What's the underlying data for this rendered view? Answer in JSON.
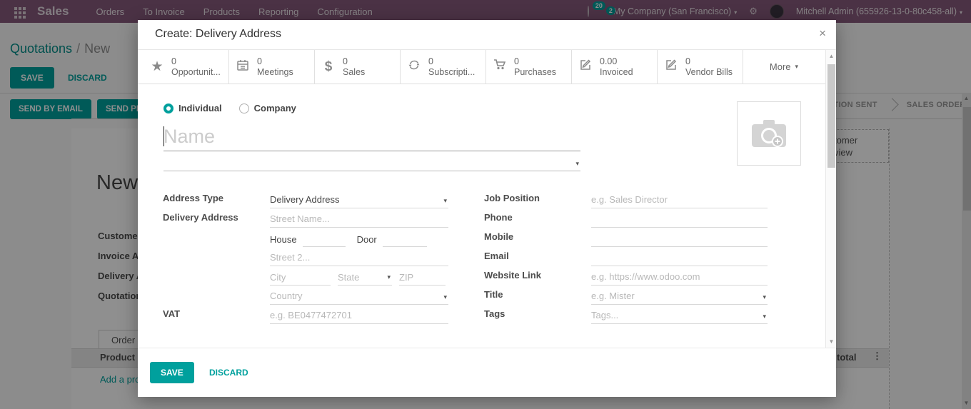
{
  "topbar": {
    "app_name": "Sales",
    "menu_items": [
      "Orders",
      "To Invoice",
      "Products",
      "Reporting",
      "Configuration"
    ],
    "activity_badge": "20",
    "message_badge": "2",
    "company": "My Company (San Francisco)",
    "user": "Mitchell Admin (655926-13-0-80c458-all)",
    "caret": "▾"
  },
  "page": {
    "breadcrumb_parent": "Quotations",
    "breadcrumb_separator": "/",
    "breadcrumb_current": "New",
    "save": "SAVE",
    "discard": "DISCARD",
    "send_by_email": "SEND BY EMAIL",
    "send_pr": "SEND PR",
    "status_steps": [
      "ATION SENT",
      "SALES ORDER"
    ],
    "record_title": "New",
    "field_labels": [
      "Customer",
      "Invoice A",
      "Delivery A",
      "Quotation"
    ],
    "preview_line1": "tomer",
    "preview_line2": "view",
    "tab_order_lines": "Order L",
    "col_product": "Product",
    "col_total": "total",
    "kebab": "⋮",
    "add_line": "Add a pro",
    "scroll_up": "▲",
    "scroll_down": "▼"
  },
  "modal": {
    "title": "Create: Delivery Address",
    "close": "×",
    "stats": [
      {
        "value": "0",
        "label": "Opportunit..."
      },
      {
        "value": "0",
        "label": "Meetings"
      },
      {
        "value": "0",
        "label": "Sales"
      },
      {
        "value": "0",
        "label": "Subscripti..."
      },
      {
        "value": "0",
        "label": "Purchases"
      },
      {
        "value": "0.00",
        "label": "Invoiced"
      },
      {
        "value": "0",
        "label": "Vendor Bills"
      }
    ],
    "star_glyph": "★",
    "dollar_glyph": "$",
    "more": "More",
    "more_caret": "▾",
    "type_individual": "Individual",
    "type_company": "Company",
    "type_selected": "Individual",
    "name_placeholder": "Name",
    "address_type_label": "Address Type",
    "address_type_value": "Delivery Address",
    "delivery_address_label": "Delivery Address",
    "street_placeholder": "Street Name...",
    "house_label": "House",
    "door_label": "Door",
    "street2_placeholder": "Street 2...",
    "city_placeholder": "City",
    "state_placeholder": "State",
    "zip_placeholder": "ZIP",
    "country_placeholder": "Country",
    "vat_label": "VAT",
    "vat_placeholder": "e.g. BE0477472701",
    "job_label": "Job Position",
    "job_placeholder": "e.g. Sales Director",
    "phone_label": "Phone",
    "phone_placeholder": "",
    "mobile_label": "Mobile",
    "mobile_placeholder": "",
    "email_label": "Email",
    "email_placeholder": "",
    "website_label": "Website Link",
    "website_placeholder": "e.g. https://www.odoo.com",
    "title_label": "Title",
    "title_placeholder": "e.g. Mister",
    "tags_label": "Tags",
    "tags_placeholder": "Tags...",
    "save": "SAVE",
    "discard": "DISCARD",
    "caret": "▾",
    "scroll_up": "▲",
    "scroll_down": "▼"
  },
  "colors": {
    "accent": "#00A09D",
    "topbar": "#875A7B",
    "badge": "#00A09D",
    "link": "#008F8A"
  }
}
